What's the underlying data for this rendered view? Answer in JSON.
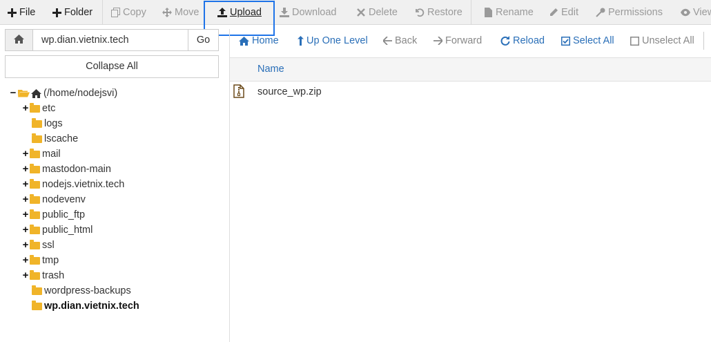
{
  "toolbar": {
    "items": [
      {
        "id": "file",
        "label": "File",
        "icon": "plus-icon",
        "enabled": true
      },
      {
        "id": "folder",
        "label": "Folder",
        "icon": "plus-icon",
        "enabled": true
      },
      {
        "id": "copy",
        "label": "Copy",
        "icon": "copy-icon",
        "enabled": false
      },
      {
        "id": "move",
        "label": "Move",
        "icon": "move-icon",
        "enabled": false
      },
      {
        "id": "upload",
        "label": "Upload",
        "icon": "upload-icon",
        "enabled": true
      },
      {
        "id": "download",
        "label": "Download",
        "icon": "download-icon",
        "enabled": false
      },
      {
        "id": "delete",
        "label": "Delete",
        "icon": "close-icon",
        "enabled": false
      },
      {
        "id": "restore",
        "label": "Restore",
        "icon": "undo-icon",
        "enabled": false
      },
      {
        "id": "rename",
        "label": "Rename",
        "icon": "file-icon",
        "enabled": false
      },
      {
        "id": "edit",
        "label": "Edit",
        "icon": "pencil-icon",
        "enabled": false
      },
      {
        "id": "permissions",
        "label": "Permissions",
        "icon": "key-icon",
        "enabled": false
      },
      {
        "id": "view",
        "label": "View",
        "icon": "eye-icon",
        "enabled": false
      }
    ]
  },
  "path_bar": {
    "home_icon": "home-icon",
    "value": "wp.dian.vietnix.tech",
    "go_label": "Go"
  },
  "collapse_label": "Collapse All",
  "tree": {
    "root_label": "(/home/nodejsvi)",
    "items": [
      {
        "name": "etc",
        "expandable": true
      },
      {
        "name": "logs",
        "expandable": false
      },
      {
        "name": "lscache",
        "expandable": false
      },
      {
        "name": "mail",
        "expandable": true
      },
      {
        "name": "mastodon-main",
        "expandable": true
      },
      {
        "name": "nodejs.vietnix.tech",
        "expandable": true
      },
      {
        "name": "nodevenv",
        "expandable": true
      },
      {
        "name": "public_ftp",
        "expandable": true
      },
      {
        "name": "public_html",
        "expandable": true
      },
      {
        "name": "ssl",
        "expandable": true
      },
      {
        "name": "tmp",
        "expandable": true
      },
      {
        "name": "trash",
        "expandable": true
      },
      {
        "name": "wordpress-backups",
        "expandable": false
      },
      {
        "name": "wp.dian.vietnix.tech",
        "expandable": false,
        "current": true
      }
    ]
  },
  "nav": {
    "home": "Home",
    "up": "Up One Level",
    "back": "Back",
    "forward": "Forward",
    "reload": "Reload",
    "select_all": "Select All",
    "unselect_all": "Unselect All"
  },
  "table": {
    "column_name": "Name",
    "files": [
      {
        "name": "source_wp.zip",
        "icon": "zip-file-icon"
      }
    ]
  },
  "colors": {
    "accent": "#2a6fb8",
    "highlight": "#1e73e8",
    "folder": "#f0b429"
  }
}
